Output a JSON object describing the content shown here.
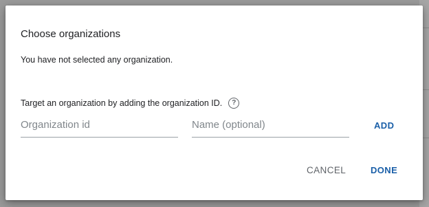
{
  "dialog": {
    "title": "Choose organizations",
    "empty_message": "You have not selected any organization.",
    "target_label": "Target an organization by adding the organization ID.",
    "help_icon_glyph": "?",
    "org_id_field": {
      "value": "",
      "placeholder": "Organization id"
    },
    "name_field": {
      "value": "",
      "placeholder": "Name (optional)"
    },
    "add_label": "ADD",
    "cancel_label": "CANCEL",
    "done_label": "DONE"
  },
  "colors": {
    "accent": "#1a5fa8",
    "text": "#202124",
    "secondary_text": "#5f6368",
    "backdrop": "#9a9a9a"
  },
  "icons": {
    "help": "help-circle-icon"
  }
}
